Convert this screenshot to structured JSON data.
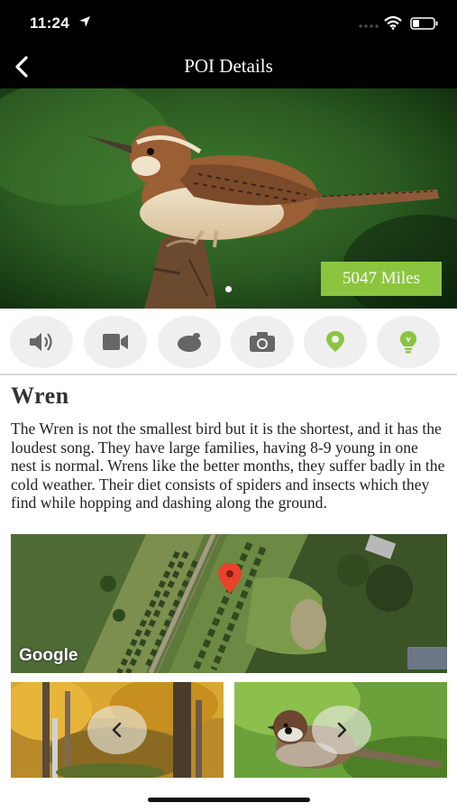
{
  "status_bar": {
    "time": "11:24",
    "icons": [
      "location-arrow-icon",
      "signal-dots-icon",
      "wifi-icon",
      "battery-icon"
    ]
  },
  "nav": {
    "title": "POI Details",
    "back_icon": "chevron-left-icon"
  },
  "hero": {
    "distance": "5047 Miles",
    "badge_color": "#8bc53f",
    "carousel_page": 1
  },
  "media_buttons": [
    {
      "icon": "speaker-icon"
    },
    {
      "icon": "video-camera-icon"
    },
    {
      "icon": "egg-icon"
    },
    {
      "icon": "camera-icon"
    },
    {
      "icon": "map-pin-icon",
      "color": "#8bc53f"
    },
    {
      "icon": "lightbulb-icon",
      "color": "#8bc53f"
    }
  ],
  "poi": {
    "name": "Wren",
    "description": "The Wren is not the smallest bird but it is the shortest, and it has the loudest song. They have large families, having 8-9 young in one nest is normal. Wrens like the better months, they suffer badly in the cold weather. Their diet consists of spiders and insects which they find while hopping and dashing along the ground."
  },
  "map": {
    "provider_logo": "Google",
    "marker_color": "#e8412c"
  },
  "gallery": {
    "prev_icon": "chevron-left-icon",
    "next_icon": "chevron-right-icon"
  },
  "colors": {
    "accent": "#8bc53f",
    "header_bg": "#000000",
    "icon_gray": "#666666"
  }
}
